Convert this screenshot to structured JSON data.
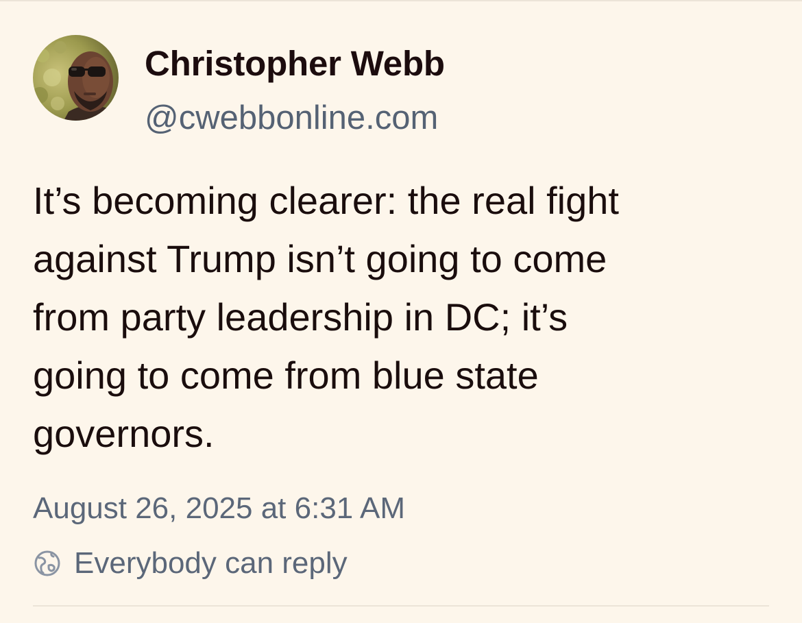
{
  "post": {
    "author": {
      "display_name": "Christopher Webb",
      "handle": "@cwebbonline.com",
      "avatar_icon": "profile-photo"
    },
    "text_lines": [
      "It’s becoming clearer: the real fight",
      "against Trump isn’t going to come",
      "from party leadership in DC; it’s",
      "going to come from blue state",
      "governors."
    ],
    "timestamp": "August 26, 2025 at 6:31 AM",
    "reply_setting": {
      "icon": "globe-icon",
      "label": "Everybody can reply"
    }
  },
  "colors": {
    "background": "#fdf6eb",
    "text": "#1a0d0d",
    "muted": "#5b6779",
    "divider": "#ece4d8"
  }
}
